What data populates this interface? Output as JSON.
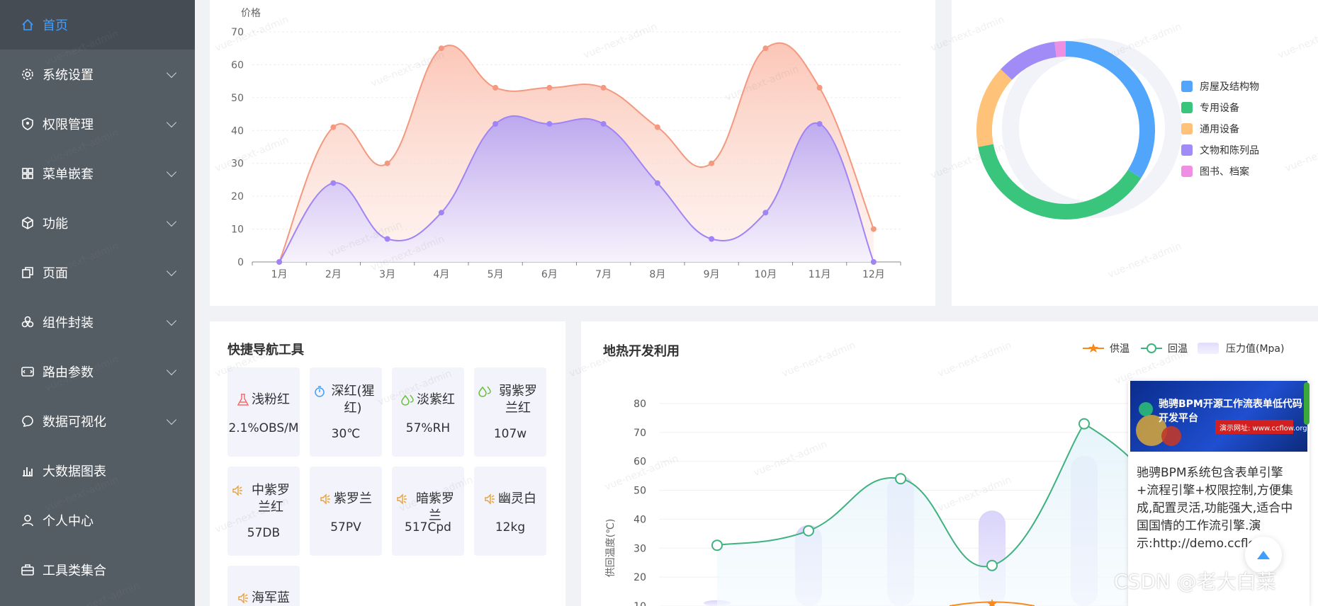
{
  "sidebar": {
    "items": [
      {
        "label": "首页",
        "icon": "home-icon",
        "active": true,
        "arrow": false
      },
      {
        "label": "系统设置",
        "icon": "gear-icon",
        "active": false,
        "arrow": true
      },
      {
        "label": "权限管理",
        "icon": "shield-icon",
        "active": false,
        "arrow": true
      },
      {
        "label": "菜单嵌套",
        "icon": "grid-icon",
        "active": false,
        "arrow": true
      },
      {
        "label": "功能",
        "icon": "box-icon",
        "active": false,
        "arrow": true
      },
      {
        "label": "页面",
        "icon": "copy-icon",
        "active": false,
        "arrow": true
      },
      {
        "label": "组件封装",
        "icon": "cubes-icon",
        "active": false,
        "arrow": true
      },
      {
        "label": "路由参数",
        "icon": "route-icon",
        "active": false,
        "arrow": true
      },
      {
        "label": "数据可视化",
        "icon": "chat-icon",
        "active": false,
        "arrow": true
      },
      {
        "label": "大数据图表",
        "icon": "bar-chart-icon",
        "active": false,
        "arrow": false
      },
      {
        "label": "个人中心",
        "icon": "user-icon",
        "active": false,
        "arrow": false
      },
      {
        "label": "工具类集合",
        "icon": "toolbox-icon",
        "active": false,
        "arrow": false
      }
    ]
  },
  "watermark": "vue-next-admin",
  "quick_nav": {
    "title": "快捷导航工具",
    "tiles": [
      {
        "name": "浅粉红",
        "value": "2.1%OBS/M",
        "icon": "flask-icon",
        "color": "#f56c6c"
      },
      {
        "name": "深红(猩红)",
        "value": "30℃",
        "icon": "timer-icon",
        "color": "#409eff"
      },
      {
        "name": "淡紫红",
        "value": "57%RH",
        "icon": "droplets-icon",
        "color": "#67c23a"
      },
      {
        "name": "弱紫罗兰红",
        "value": "107w",
        "icon": "droplets-icon",
        "color": "#67c23a"
      },
      {
        "name": "中紫罗兰红",
        "value": "57DB",
        "icon": "speaker-icon",
        "color": "#e6a23c"
      },
      {
        "name": "紫罗兰",
        "value": "57PV",
        "icon": "speaker-icon",
        "color": "#e6a23c"
      },
      {
        "name": "暗紫罗兰",
        "value": "517Cpd",
        "icon": "speaker-icon",
        "color": "#e6a23c"
      },
      {
        "name": "幽灵白",
        "value": "12kg",
        "icon": "speaker-icon",
        "color": "#e6a23c"
      },
      {
        "name": "海军蓝",
        "value": "",
        "icon": "speaker-icon",
        "color": "#e6a23c"
      }
    ]
  },
  "geo_chart": {
    "title": "地热开发利用",
    "legend": [
      "供温",
      "回温",
      "压力值(Mpa)"
    ]
  },
  "ad": {
    "banner_title": "驰骋BPM开源工作流表单低代码开发平台",
    "banner_sub": "演示网址: www.ccflow.org",
    "text": "驰骋BPM系统包含表单引擎+流程引擎+权限控制,方便集成,配置灵活,功能强大,适合中国国情的工作流引擎.演示:http://demo.ccflow"
  },
  "footer_watermark": "CSDN @老大白菜",
  "chart_data": [
    {
      "type": "area",
      "ylabel": "价格",
      "ylim": [
        0,
        70
      ],
      "yticks": [
        0,
        10,
        20,
        30,
        40,
        50,
        60,
        70
      ],
      "categories": [
        "1月",
        "2月",
        "3月",
        "4月",
        "5月",
        "6月",
        "7月",
        "8月",
        "9月",
        "10月",
        "11月",
        "12月"
      ],
      "series": [
        {
          "values": [
            0,
            41,
            30,
            65,
            53,
            53,
            53,
            41,
            30,
            65,
            53,
            10
          ],
          "color": "#f4987f"
        },
        {
          "values": [
            0,
            24,
            7,
            15,
            42,
            42,
            42,
            24,
            7,
            15,
            42,
            0
          ],
          "color": "#a084f5"
        }
      ]
    },
    {
      "type": "pie",
      "labels": [
        "房屋及结构物",
        "专用设备",
        "通用设备",
        "文物和陈列品",
        "图书、档案"
      ],
      "values": [
        34,
        38,
        15,
        11,
        2
      ],
      "colors": [
        "#51a5fa",
        "#3ac57d",
        "#fec278",
        "#a18bf6",
        "#ee8fe3"
      ]
    },
    {
      "type": "line",
      "ylabel": "供回温度(℃)",
      "ylim_visible": [
        10,
        80
      ],
      "yticks": [
        10,
        20,
        30,
        40,
        50,
        60,
        70,
        80
      ],
      "series": [
        {
          "name": "回温",
          "values": [
            31,
            36,
            54,
            24,
            73
          ],
          "color": "#3fb27f"
        },
        {
          "name": "压力值(Mpa)",
          "values": [
            12,
            38,
            55,
            43,
            62
          ],
          "color": "#c9c6f7"
        }
      ],
      "right_axis_tick": "10"
    }
  ]
}
